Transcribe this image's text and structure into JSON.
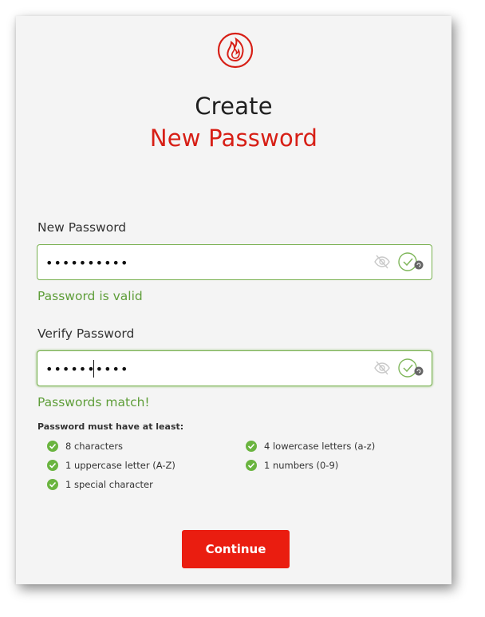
{
  "logo": {
    "icon": "flame-logo-icon",
    "color": "#d71f16"
  },
  "heading": {
    "line1": "Create",
    "line2": "New Password"
  },
  "new_password": {
    "label": "New Password",
    "value": "••••••••••",
    "status": "Password is valid"
  },
  "verify_password": {
    "label": "Verify Password",
    "value": "••••••••••",
    "status": "Passwords match!"
  },
  "requirements": {
    "title": "Password must have at least:",
    "items": [
      {
        "text": "8 characters",
        "met": true
      },
      {
        "text": "4 lowercase letters (a-z)",
        "met": true
      },
      {
        "text": "1 uppercase letter (A-Z)",
        "met": true
      },
      {
        "text": "1 numbers (0-9)",
        "met": true
      },
      {
        "text": "1 special character",
        "met": true
      }
    ]
  },
  "continue_button": {
    "label": "Continue"
  },
  "colors": {
    "accent": "#d71f16",
    "valid": "#5f9e3a",
    "button": "#ea1d10"
  }
}
